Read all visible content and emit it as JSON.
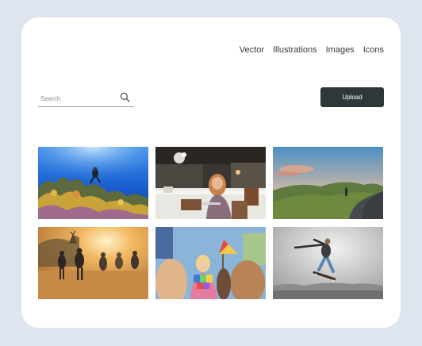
{
  "nav": {
    "items": [
      "Vector",
      "Illustrations",
      "Images",
      "Icons"
    ]
  },
  "search": {
    "placeholder": "Search",
    "icon": "search-icon"
  },
  "upload": {
    "label": "Upload"
  },
  "gallery": {
    "images": [
      {
        "name": "underwater-diver-photo"
      },
      {
        "name": "woman-cafe-laptop-photo"
      },
      {
        "name": "road-hills-cyclist-photo"
      },
      {
        "name": "people-running-field-photo"
      },
      {
        "name": "festival-crowd-photo"
      },
      {
        "name": "skateboarder-jump-photo"
      }
    ]
  },
  "colors": {
    "background": "#dfe5ee",
    "card": "#ffffff",
    "button": "#2f373a"
  }
}
